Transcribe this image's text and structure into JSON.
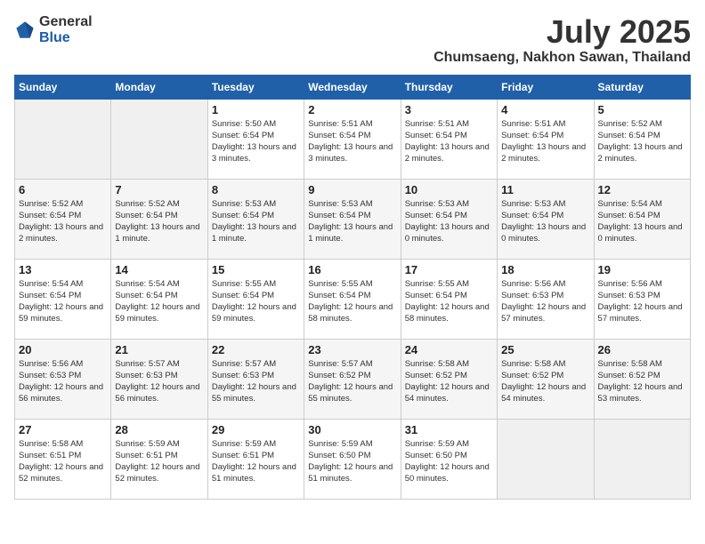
{
  "logo": {
    "general": "General",
    "blue": "Blue"
  },
  "title": "July 2025",
  "location": "Chumsaeng, Nakhon Sawan, Thailand",
  "weekdays": [
    "Sunday",
    "Monday",
    "Tuesday",
    "Wednesday",
    "Thursday",
    "Friday",
    "Saturday"
  ],
  "weeks": [
    [
      {
        "day": "",
        "info": ""
      },
      {
        "day": "",
        "info": ""
      },
      {
        "day": "1",
        "info": "Sunrise: 5:50 AM\nSunset: 6:54 PM\nDaylight: 13 hours and 3 minutes."
      },
      {
        "day": "2",
        "info": "Sunrise: 5:51 AM\nSunset: 6:54 PM\nDaylight: 13 hours and 3 minutes."
      },
      {
        "day": "3",
        "info": "Sunrise: 5:51 AM\nSunset: 6:54 PM\nDaylight: 13 hours and 2 minutes."
      },
      {
        "day": "4",
        "info": "Sunrise: 5:51 AM\nSunset: 6:54 PM\nDaylight: 13 hours and 2 minutes."
      },
      {
        "day": "5",
        "info": "Sunrise: 5:52 AM\nSunset: 6:54 PM\nDaylight: 13 hours and 2 minutes."
      }
    ],
    [
      {
        "day": "6",
        "info": "Sunrise: 5:52 AM\nSunset: 6:54 PM\nDaylight: 13 hours and 2 minutes."
      },
      {
        "day": "7",
        "info": "Sunrise: 5:52 AM\nSunset: 6:54 PM\nDaylight: 13 hours and 1 minute."
      },
      {
        "day": "8",
        "info": "Sunrise: 5:53 AM\nSunset: 6:54 PM\nDaylight: 13 hours and 1 minute."
      },
      {
        "day": "9",
        "info": "Sunrise: 5:53 AM\nSunset: 6:54 PM\nDaylight: 13 hours and 1 minute."
      },
      {
        "day": "10",
        "info": "Sunrise: 5:53 AM\nSunset: 6:54 PM\nDaylight: 13 hours and 0 minutes."
      },
      {
        "day": "11",
        "info": "Sunrise: 5:53 AM\nSunset: 6:54 PM\nDaylight: 13 hours and 0 minutes."
      },
      {
        "day": "12",
        "info": "Sunrise: 5:54 AM\nSunset: 6:54 PM\nDaylight: 13 hours and 0 minutes."
      }
    ],
    [
      {
        "day": "13",
        "info": "Sunrise: 5:54 AM\nSunset: 6:54 PM\nDaylight: 12 hours and 59 minutes."
      },
      {
        "day": "14",
        "info": "Sunrise: 5:54 AM\nSunset: 6:54 PM\nDaylight: 12 hours and 59 minutes."
      },
      {
        "day": "15",
        "info": "Sunrise: 5:55 AM\nSunset: 6:54 PM\nDaylight: 12 hours and 59 minutes."
      },
      {
        "day": "16",
        "info": "Sunrise: 5:55 AM\nSunset: 6:54 PM\nDaylight: 12 hours and 58 minutes."
      },
      {
        "day": "17",
        "info": "Sunrise: 5:55 AM\nSunset: 6:54 PM\nDaylight: 12 hours and 58 minutes."
      },
      {
        "day": "18",
        "info": "Sunrise: 5:56 AM\nSunset: 6:53 PM\nDaylight: 12 hours and 57 minutes."
      },
      {
        "day": "19",
        "info": "Sunrise: 5:56 AM\nSunset: 6:53 PM\nDaylight: 12 hours and 57 minutes."
      }
    ],
    [
      {
        "day": "20",
        "info": "Sunrise: 5:56 AM\nSunset: 6:53 PM\nDaylight: 12 hours and 56 minutes."
      },
      {
        "day": "21",
        "info": "Sunrise: 5:57 AM\nSunset: 6:53 PM\nDaylight: 12 hours and 56 minutes."
      },
      {
        "day": "22",
        "info": "Sunrise: 5:57 AM\nSunset: 6:53 PM\nDaylight: 12 hours and 55 minutes."
      },
      {
        "day": "23",
        "info": "Sunrise: 5:57 AM\nSunset: 6:52 PM\nDaylight: 12 hours and 55 minutes."
      },
      {
        "day": "24",
        "info": "Sunrise: 5:58 AM\nSunset: 6:52 PM\nDaylight: 12 hours and 54 minutes."
      },
      {
        "day": "25",
        "info": "Sunrise: 5:58 AM\nSunset: 6:52 PM\nDaylight: 12 hours and 54 minutes."
      },
      {
        "day": "26",
        "info": "Sunrise: 5:58 AM\nSunset: 6:52 PM\nDaylight: 12 hours and 53 minutes."
      }
    ],
    [
      {
        "day": "27",
        "info": "Sunrise: 5:58 AM\nSunset: 6:51 PM\nDaylight: 12 hours and 52 minutes."
      },
      {
        "day": "28",
        "info": "Sunrise: 5:59 AM\nSunset: 6:51 PM\nDaylight: 12 hours and 52 minutes."
      },
      {
        "day": "29",
        "info": "Sunrise: 5:59 AM\nSunset: 6:51 PM\nDaylight: 12 hours and 51 minutes."
      },
      {
        "day": "30",
        "info": "Sunrise: 5:59 AM\nSunset: 6:50 PM\nDaylight: 12 hours and 51 minutes."
      },
      {
        "day": "31",
        "info": "Sunrise: 5:59 AM\nSunset: 6:50 PM\nDaylight: 12 hours and 50 minutes."
      },
      {
        "day": "",
        "info": ""
      },
      {
        "day": "",
        "info": ""
      }
    ]
  ]
}
